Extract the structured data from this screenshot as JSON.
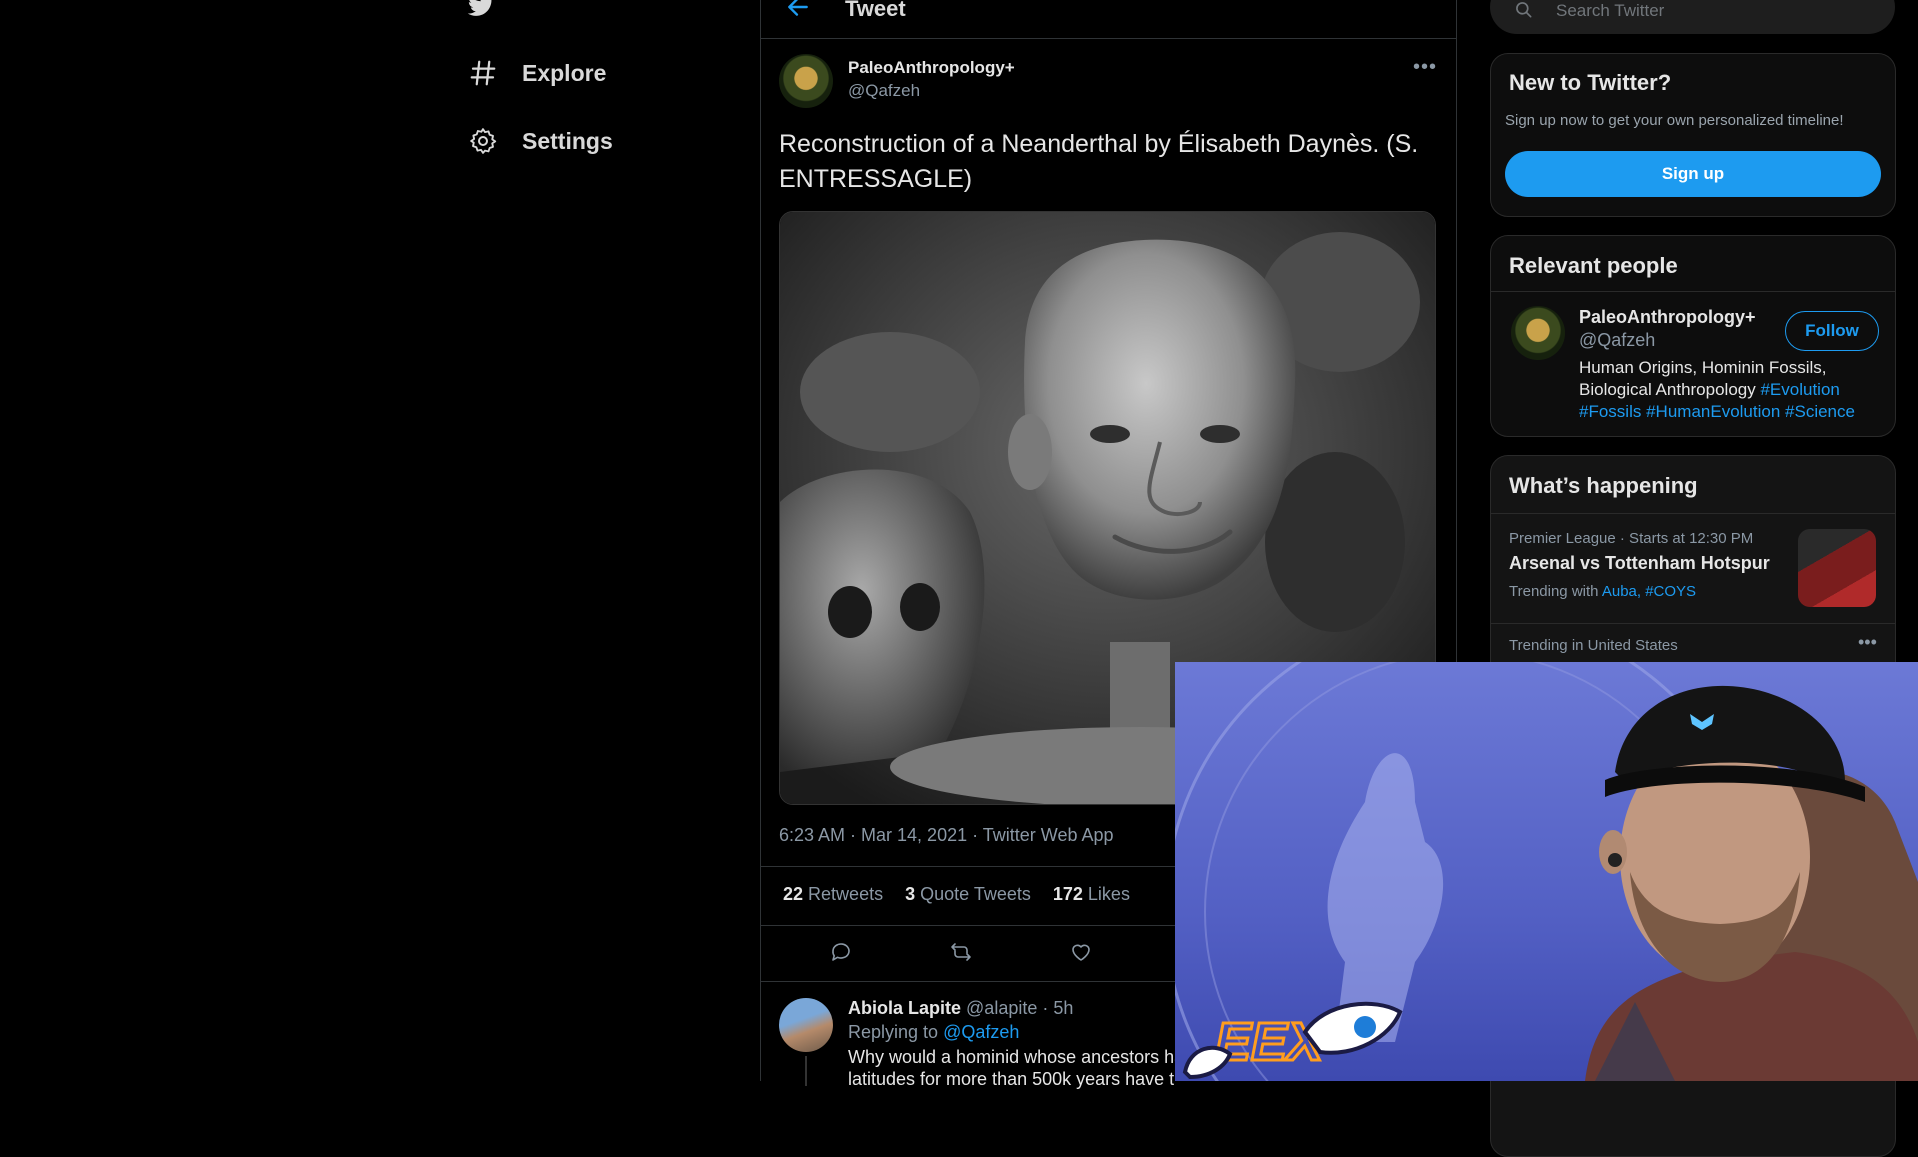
{
  "nav": {
    "items": [
      {
        "label": "Explore",
        "icon": "hashtag-icon"
      },
      {
        "label": "Settings",
        "icon": "gear-icon"
      }
    ]
  },
  "header": {
    "title": "Tweet"
  },
  "tweet": {
    "author_name": "PaleoAnthropology+",
    "author_handle": "@Qafzeh",
    "text": "Reconstruction of a Neanderthal by Élisabeth Daynès. (S. ENTRESSAGLE)",
    "meta": "6:23 AM · Mar 14, 2021 · Twitter Web App",
    "stats": {
      "retweets_count": "22",
      "retweets_label": "Retweets",
      "quotes_count": "3",
      "quotes_label": "Quote Tweets",
      "likes_count": "172",
      "likes_label": "Likes"
    }
  },
  "reply": {
    "name": "Abiola Lapite",
    "handle_time": "@alapite · 5h",
    "replying_prefix": "Replying to",
    "replying_to": "@Qafzeh",
    "line1": "Why would a hominid whose ancestors ha",
    "line2": "latitudes for more than 500k years have t"
  },
  "search": {
    "placeholder": "Search Twitter"
  },
  "new_to_twitter": {
    "title": "New to Twitter?",
    "subtitle": "Sign up now to get your own personalized timeline!",
    "button": "Sign up"
  },
  "relevant_people": {
    "title": "Relevant people",
    "name": "PaleoAnthropology+",
    "handle": "@Qafzeh",
    "follow": "Follow",
    "bio_text": "Human Origins, Hominin Fossils, Biological Anthropology",
    "bio_tags": [
      "#Evolution",
      "#Fossils",
      "#HumanEvolution",
      "#Science"
    ]
  },
  "whats_happening": {
    "title": "What’s happening",
    "trend1": {
      "meta": "Premier League · Starts at 12:30 PM",
      "title": "Arsenal vs Tottenham Hotspur",
      "with_label": "Trending with",
      "with_tags": "Auba, #COYS"
    },
    "trend2": {
      "meta": "Trending in United States"
    }
  },
  "overlay": {
    "logo_text": "EEX"
  },
  "colors": {
    "accent": "#1d9bf0",
    "background": "#000000",
    "card": "#0d0d0d"
  }
}
